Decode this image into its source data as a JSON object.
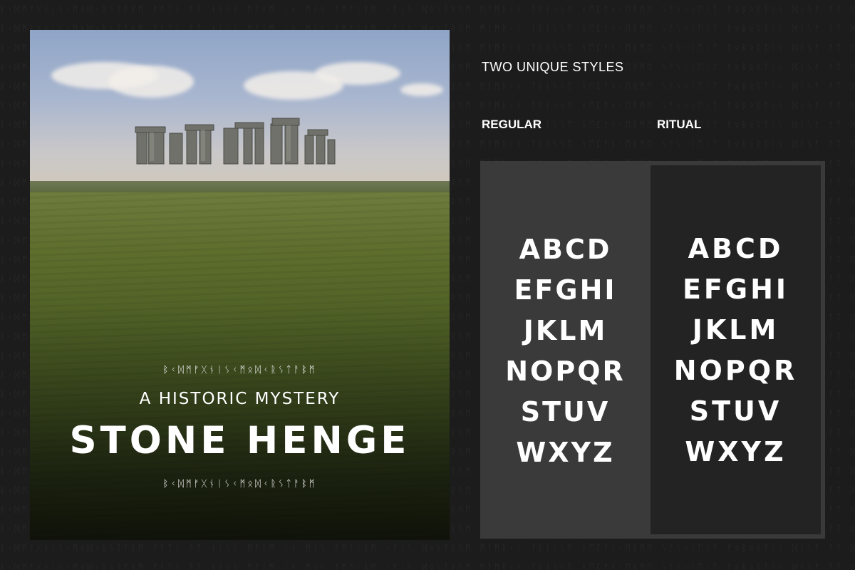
{
  "background": {
    "rune_text": "ᛒᚲᛞᛗᚠᚷᚾᛁᛊᚲᛗᛟᛞᚲᚱᛊᛏᚨᛒᛗ ᚠᚨᛏᛁ ᚨᛏ ᚾᛁᛊᛁ ᛗᚨᛁᛗ ᛁᚾ ᛗᛁᛊ ᚠᛗᚨᛁᚱᛗ ᚲᚨᛁᛊ ᛞᛟᛊᛏᚱᚢᛗ ᛗᚨᛗᚱᚲᛁ ᛏᚱᛁᛊᛊᛖ ᚾᛖᛈᚠᚾᚲᛖᚱᛗᛖ ᛊᚨᛊᚲᛁᛖᛁᛏ ᚠᛟᛒᛟᚱᛏᛁᛊ ᛞᛁᛊᚠ ᚨᛏ ᛞᚱᛗᛁᚲᚾᛁᚲ"
  },
  "poster": {
    "rune_top": "ᛒᚲᛞᛗᚠᚷᚾᛁᛊᚲᛗᛟᛞᚲᚱᛊᛏᚨᛒᛗ",
    "subtitle": "A HISTORIC MYSTERY",
    "title": "STONE HENGE",
    "rune_bottom": "ᛒᚲᛞᛗᚠᚷᚾᛁᛊᚲᛗᛟᛞᚲᚱᛊᛏᚨᛒᛗ"
  },
  "showcase": {
    "heading": "TWO UNIQUE STYLES",
    "regular_label": "REGULAR",
    "ritual_label": "RITUAL",
    "regular_rows": [
      "ABCD",
      "EFGHI",
      "JKLM",
      "NOPQR",
      "STUV",
      "WXYZ"
    ],
    "ritual_rows": [
      "ABCD",
      "EFGHI",
      "JKLM",
      "NOPQR",
      "STUV",
      "WXYZ"
    ]
  },
  "colors": {
    "page_bg": "#1c1c1c",
    "panel_regular": "#3a3a3a",
    "panel_ritual": "#232323",
    "text": "#ffffff"
  }
}
